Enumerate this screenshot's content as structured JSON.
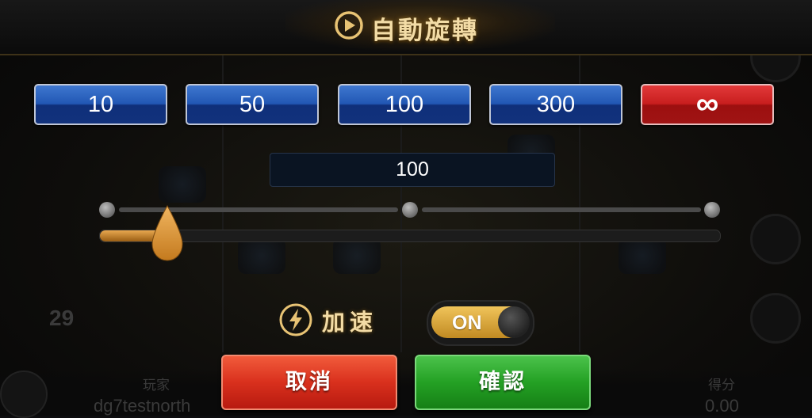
{
  "header": {
    "title": "自動旋轉"
  },
  "counts": [
    {
      "label": "10",
      "selected": false
    },
    {
      "label": "50",
      "selected": false
    },
    {
      "label": "100",
      "selected": false
    },
    {
      "label": "300",
      "selected": false
    },
    {
      "label": "∞",
      "selected": true
    }
  ],
  "display": {
    "value": "100"
  },
  "slider": {
    "fill_fraction": 0.11
  },
  "turbo": {
    "label": "加速",
    "toggle": "ON",
    "enabled": true
  },
  "actions": {
    "cancel": "取消",
    "confirm": "確認"
  },
  "background": {
    "player_label": "玩家",
    "player_name": "dg7testnorth",
    "score_label": "得分",
    "score_value": "0.00",
    "side_number": "29"
  },
  "colors": {
    "accent_gold": "#f3dca6",
    "count_button_blue": "#2157b4",
    "count_button_selected_red": "#c81e1e",
    "cancel_red": "#d9301d",
    "confirm_green": "#24a124",
    "slider_fill": "#d08c35"
  },
  "icons": {
    "title": "play-circle-icon",
    "turbo": "lightning-bolt-icon",
    "slider_thumb": "droplet-thumb-icon",
    "bottom_left": "menu-icon"
  }
}
